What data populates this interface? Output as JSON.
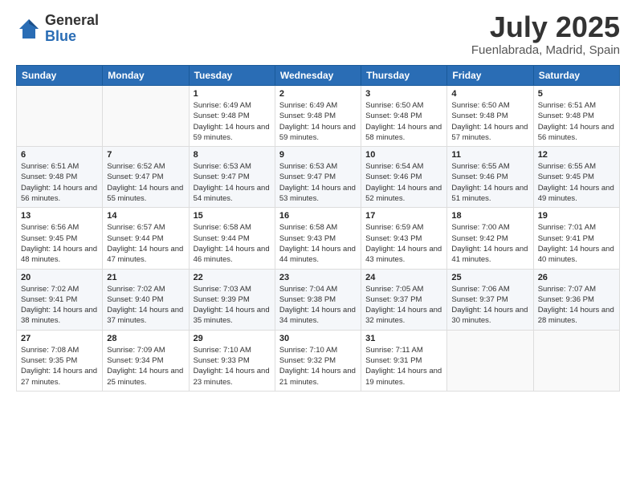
{
  "logo": {
    "general": "General",
    "blue": "Blue"
  },
  "title": "July 2025",
  "location": "Fuenlabrada, Madrid, Spain",
  "days_of_week": [
    "Sunday",
    "Monday",
    "Tuesday",
    "Wednesday",
    "Thursday",
    "Friday",
    "Saturday"
  ],
  "weeks": [
    [
      {
        "day": "",
        "info": ""
      },
      {
        "day": "",
        "info": ""
      },
      {
        "day": "1",
        "info": "Sunrise: 6:49 AM\nSunset: 9:48 PM\nDaylight: 14 hours and 59 minutes."
      },
      {
        "day": "2",
        "info": "Sunrise: 6:49 AM\nSunset: 9:48 PM\nDaylight: 14 hours and 59 minutes."
      },
      {
        "day": "3",
        "info": "Sunrise: 6:50 AM\nSunset: 9:48 PM\nDaylight: 14 hours and 58 minutes."
      },
      {
        "day": "4",
        "info": "Sunrise: 6:50 AM\nSunset: 9:48 PM\nDaylight: 14 hours and 57 minutes."
      },
      {
        "day": "5",
        "info": "Sunrise: 6:51 AM\nSunset: 9:48 PM\nDaylight: 14 hours and 56 minutes."
      }
    ],
    [
      {
        "day": "6",
        "info": "Sunrise: 6:51 AM\nSunset: 9:48 PM\nDaylight: 14 hours and 56 minutes."
      },
      {
        "day": "7",
        "info": "Sunrise: 6:52 AM\nSunset: 9:47 PM\nDaylight: 14 hours and 55 minutes."
      },
      {
        "day": "8",
        "info": "Sunrise: 6:53 AM\nSunset: 9:47 PM\nDaylight: 14 hours and 54 minutes."
      },
      {
        "day": "9",
        "info": "Sunrise: 6:53 AM\nSunset: 9:47 PM\nDaylight: 14 hours and 53 minutes."
      },
      {
        "day": "10",
        "info": "Sunrise: 6:54 AM\nSunset: 9:46 PM\nDaylight: 14 hours and 52 minutes."
      },
      {
        "day": "11",
        "info": "Sunrise: 6:55 AM\nSunset: 9:46 PM\nDaylight: 14 hours and 51 minutes."
      },
      {
        "day": "12",
        "info": "Sunrise: 6:55 AM\nSunset: 9:45 PM\nDaylight: 14 hours and 49 minutes."
      }
    ],
    [
      {
        "day": "13",
        "info": "Sunrise: 6:56 AM\nSunset: 9:45 PM\nDaylight: 14 hours and 48 minutes."
      },
      {
        "day": "14",
        "info": "Sunrise: 6:57 AM\nSunset: 9:44 PM\nDaylight: 14 hours and 47 minutes."
      },
      {
        "day": "15",
        "info": "Sunrise: 6:58 AM\nSunset: 9:44 PM\nDaylight: 14 hours and 46 minutes."
      },
      {
        "day": "16",
        "info": "Sunrise: 6:58 AM\nSunset: 9:43 PM\nDaylight: 14 hours and 44 minutes."
      },
      {
        "day": "17",
        "info": "Sunrise: 6:59 AM\nSunset: 9:43 PM\nDaylight: 14 hours and 43 minutes."
      },
      {
        "day": "18",
        "info": "Sunrise: 7:00 AM\nSunset: 9:42 PM\nDaylight: 14 hours and 41 minutes."
      },
      {
        "day": "19",
        "info": "Sunrise: 7:01 AM\nSunset: 9:41 PM\nDaylight: 14 hours and 40 minutes."
      }
    ],
    [
      {
        "day": "20",
        "info": "Sunrise: 7:02 AM\nSunset: 9:41 PM\nDaylight: 14 hours and 38 minutes."
      },
      {
        "day": "21",
        "info": "Sunrise: 7:02 AM\nSunset: 9:40 PM\nDaylight: 14 hours and 37 minutes."
      },
      {
        "day": "22",
        "info": "Sunrise: 7:03 AM\nSunset: 9:39 PM\nDaylight: 14 hours and 35 minutes."
      },
      {
        "day": "23",
        "info": "Sunrise: 7:04 AM\nSunset: 9:38 PM\nDaylight: 14 hours and 34 minutes."
      },
      {
        "day": "24",
        "info": "Sunrise: 7:05 AM\nSunset: 9:37 PM\nDaylight: 14 hours and 32 minutes."
      },
      {
        "day": "25",
        "info": "Sunrise: 7:06 AM\nSunset: 9:37 PM\nDaylight: 14 hours and 30 minutes."
      },
      {
        "day": "26",
        "info": "Sunrise: 7:07 AM\nSunset: 9:36 PM\nDaylight: 14 hours and 28 minutes."
      }
    ],
    [
      {
        "day": "27",
        "info": "Sunrise: 7:08 AM\nSunset: 9:35 PM\nDaylight: 14 hours and 27 minutes."
      },
      {
        "day": "28",
        "info": "Sunrise: 7:09 AM\nSunset: 9:34 PM\nDaylight: 14 hours and 25 minutes."
      },
      {
        "day": "29",
        "info": "Sunrise: 7:10 AM\nSunset: 9:33 PM\nDaylight: 14 hours and 23 minutes."
      },
      {
        "day": "30",
        "info": "Sunrise: 7:10 AM\nSunset: 9:32 PM\nDaylight: 14 hours and 21 minutes."
      },
      {
        "day": "31",
        "info": "Sunrise: 7:11 AM\nSunset: 9:31 PM\nDaylight: 14 hours and 19 minutes."
      },
      {
        "day": "",
        "info": ""
      },
      {
        "day": "",
        "info": ""
      }
    ]
  ]
}
